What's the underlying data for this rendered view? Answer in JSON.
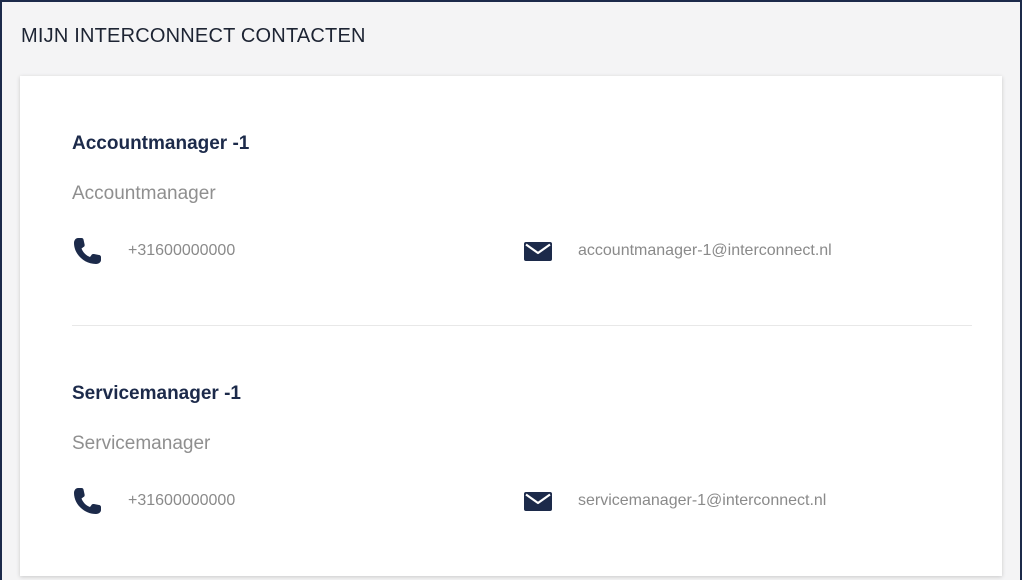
{
  "panel": {
    "title": "MIJN INTERCONNECT CONTACTEN"
  },
  "contacts": [
    {
      "name": "Accountmanager -1",
      "role": "Accountmanager",
      "phone": "+31600000000",
      "email": "accountmanager-1@interconnect.nl",
      "phone_icon": "phone-icon",
      "email_icon": "envelope-icon"
    },
    {
      "name": "Servicemanager -1",
      "role": "Servicemanager",
      "phone": "+31600000000",
      "email": "servicemanager-1@interconnect.nl",
      "phone_icon": "phone-icon",
      "email_icon": "envelope-icon"
    }
  ],
  "colors": {
    "navy": "#1c2a4a",
    "muted_text": "#8a8a8a",
    "panel_bg": "#f4f4f5"
  }
}
